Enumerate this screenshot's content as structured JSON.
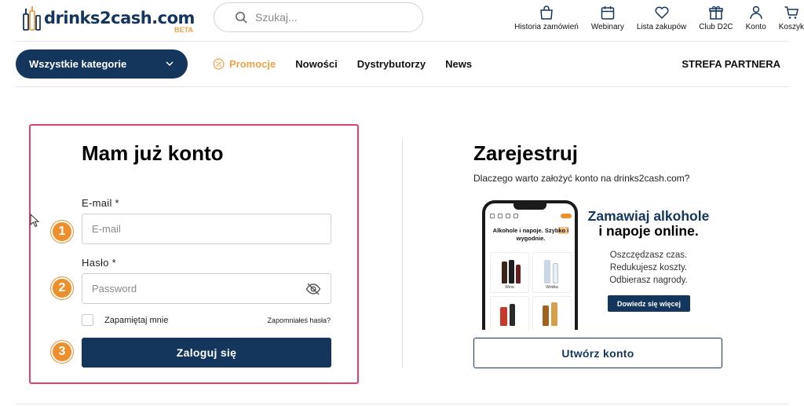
{
  "header": {
    "logo_text": "drinks2cash.com",
    "logo_badge": "BETA",
    "search_placeholder": "Szukaj...",
    "icons": [
      {
        "label": "Historia zamówień",
        "icon": "bag-icon"
      },
      {
        "label": "Webinary",
        "icon": "calendar-icon"
      },
      {
        "label": "Lista zakupów",
        "icon": "heart-icon"
      },
      {
        "label": "Club D2C",
        "icon": "gift-icon"
      },
      {
        "label": "Konto",
        "icon": "user-icon"
      },
      {
        "label": "Koszyk",
        "icon": "cart-icon"
      }
    ]
  },
  "nav": {
    "categories_label": "Wszystkie kategorie",
    "promo": "Promocje",
    "items": [
      "Nowości",
      "Dystrybutorzy",
      "News"
    ],
    "partner": "STREFA PARTNERA"
  },
  "login": {
    "title": "Mam już konto",
    "email_label": "E-mail *",
    "email_placeholder": "E-mail",
    "password_label": "Hasło *",
    "password_placeholder": "Password",
    "remember": "Zapamiętaj mnie",
    "forgot": "Zapomniałeś hasła?",
    "submit": "Zaloguj się",
    "steps": [
      "1",
      "2",
      "3"
    ]
  },
  "register": {
    "title": "Zarejestruj",
    "subtitle": "Dlaczego warto założyć konto na drinks2cash.com?",
    "phone_text_a": "Alkohole i napoje. Szyb",
    "phone_text_hl": "ko i",
    "phone_text_b": "wygodnie.",
    "tile_labels": [
      "Wina",
      "Wódka"
    ],
    "promo_line1": "Zamawiaj alkohole",
    "promo_line2": "i napoje online.",
    "benefits": [
      "Oszczędzasz czas.",
      "Redukujesz koszty.",
      "Odbierasz nagrody."
    ],
    "learn_more": "Dowiedz się więcej",
    "create": "Utwórz konto"
  },
  "colors": {
    "navy": "#14365d",
    "orange": "#ee8f2d",
    "highlight_border": "#e0436a"
  }
}
